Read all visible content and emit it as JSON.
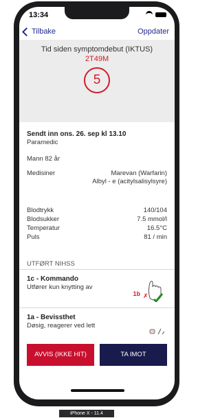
{
  "status": {
    "time": "13:34"
  },
  "nav": {
    "back_label": "Tilbake",
    "update_label": "Oppdater"
  },
  "header": {
    "title": "Tid siden symptomdebut (IKTUS)",
    "timer": "2T49M",
    "score": "5"
  },
  "report": {
    "sent": "Sendt inn ons. 26. sep kl 13.10",
    "sender": "Paramedic",
    "patient": "Mann 82 år",
    "medication_label": "Medisiner",
    "medications": [
      "Marevan (Warfarin)",
      "Albyl - e (acitylsalisylsyre)"
    ]
  },
  "vitals": [
    {
      "label": "Blodtrykk",
      "value": "140/104"
    },
    {
      "label": "Blodsukker",
      "value": "7.5 mmol/l"
    },
    {
      "label": "Temperatur",
      "value": "16.5°C"
    },
    {
      "label": "Puls",
      "value": "81 / min"
    }
  ],
  "nihss": {
    "section_title": "UTFØRT NIHSS",
    "items": [
      {
        "title": "1c - Kommando",
        "desc": "Utfører kun knytting av",
        "tag": "1b"
      },
      {
        "title": "1a - Bevissthet",
        "desc": "Døsig, reagerer ved lett"
      }
    ]
  },
  "actions": {
    "reject_label": "AVVIS (IKKE HIT)",
    "accept_label": "TA IMOT"
  },
  "colors": {
    "brand_blue": "#1f2a8c",
    "accent_red": "#d11a2a",
    "reject": "#c8102e",
    "accept": "#191b4d"
  },
  "device_label": "iPhone X - 11.4"
}
